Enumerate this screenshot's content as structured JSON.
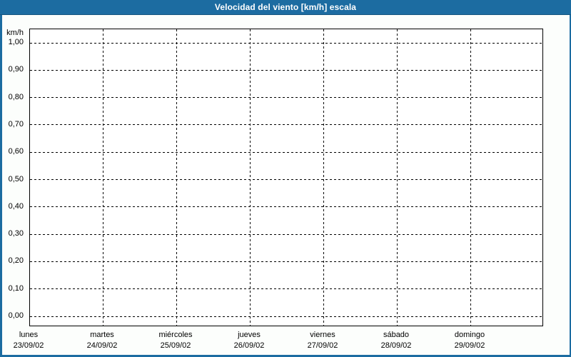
{
  "window": {
    "title": "Velocidad del viento [km/h] escala"
  },
  "colors": {
    "titlebar_background": "#1c6ca1",
    "titlebar_bottom_edge": "#15557f",
    "titlebar_text": "#ffffff",
    "window_border": "#1c6ca1",
    "chart_background": "#fcfefc",
    "plot_background": "#ffffff",
    "grid_and_axis": "#000000",
    "label_text": "#000000"
  },
  "chart_data": {
    "type": "line",
    "title": "Velocidad del viento [km/h] escala",
    "ylabel_unit": "km/h",
    "ylim": [
      0.0,
      1.0
    ],
    "ytick_step": 0.1,
    "ytick_labels": [
      "1,00",
      "0,90",
      "0,80",
      "0,70",
      "0,60",
      "0,50",
      "0,40",
      "0,30",
      "0,20",
      "0,10",
      "0,00"
    ],
    "x_categories": [
      {
        "day": "lunes",
        "date": "23/09/02"
      },
      {
        "day": "martes",
        "date": "24/09/02"
      },
      {
        "day": "miércoles",
        "date": "25/09/02"
      },
      {
        "day": "jueves",
        "date": "26/09/02"
      },
      {
        "day": "viernes",
        "date": "27/09/02"
      },
      {
        "day": "sábado",
        "date": "28/09/02"
      },
      {
        "day": "domingo",
        "date": "29/09/02"
      }
    ],
    "x_days_span": 7,
    "series": [],
    "grid": "dashed",
    "legend": "none"
  }
}
